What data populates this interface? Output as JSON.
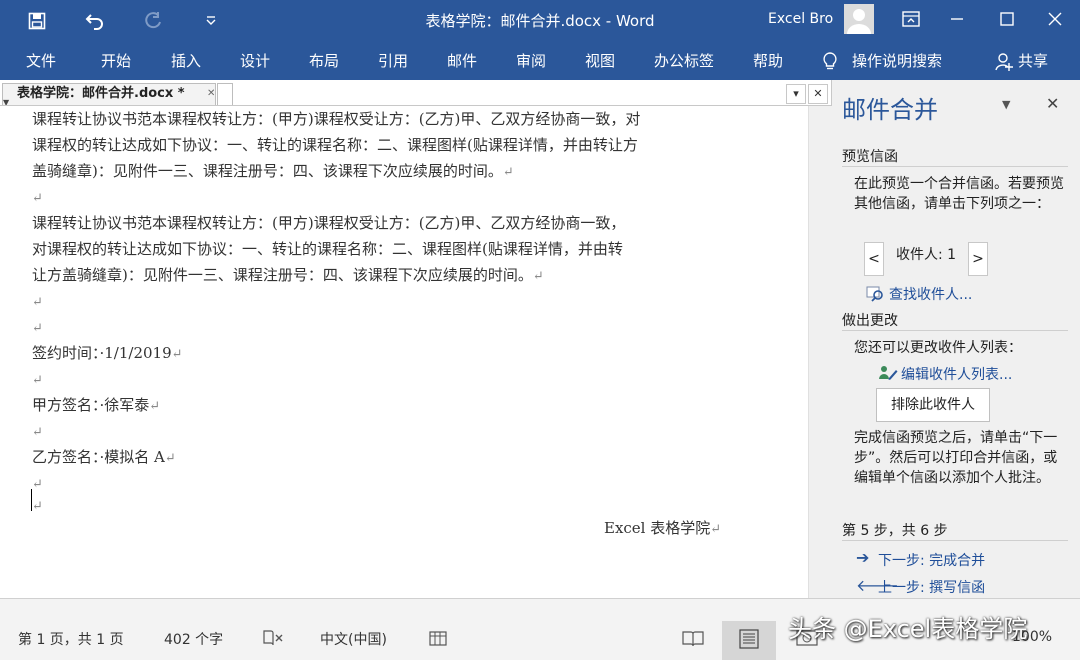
{
  "app": {
    "window_title": "表格学院：邮件合并.docx  -  Word",
    "user_name": "Excel Bro"
  },
  "ribbon": {
    "tabs": [
      "文件",
      "开始",
      "插入",
      "设计",
      "布局",
      "引用",
      "邮件",
      "审阅",
      "视图",
      "办公标签",
      "帮助"
    ],
    "tell_me": "操作说明搜索",
    "share": "共享"
  },
  "document": {
    "tab_name": "表格学院：邮件合并.docx *",
    "lines": [
      "课程转让协议书范本课程权转让方：(甲方)课程权受让方：(乙方)甲、乙双方经协商一致，对",
      "课程权的转让达成如下协议：一、转让的课程名称：二、课程图样(贴课程详情，并由转让方",
      "盖骑缝章)：见附件一三、课程注册号：四、该课程下次应续展的时间。",
      "",
      "课程转让协议书范本课程权转让方：(甲方)课程权受让方：(乙方)甲、乙双方经协商一致，",
      "对课程权的转让达成如下协议：一、转让的课程名称：二、课程图样(贴课程详情，并由转",
      "让方盖骑缝章)：见附件一三、课程注册号：四、该课程下次应续展的时间。",
      "",
      "",
      "签约时间：·1/1/2019",
      "",
      "甲方签名：·徐军泰",
      "",
      "乙方签名：·模拟名 A",
      "",
      ""
    ],
    "signature": "Excel 表格学院"
  },
  "pane": {
    "title": "邮件合并",
    "preview_title": "预览信函",
    "preview_text": "在此预览一个合并信函。若要预览其他信函，请单击下列项之一：",
    "recipient_label": "收件人: 1",
    "prev": "<",
    "next": ">",
    "find_recipient": "查找收件人...",
    "make_changes_title": "做出更改",
    "change_text": "您还可以更改收件人列表：",
    "edit_list": "编辑收件人列表...",
    "exclude_button": "排除此收件人",
    "finish_text": "完成信函预览之后，请单击“下一步”。然后可以打印合并信函，或编辑单个信函以添加个人批注。",
    "step_label": "第 5 步，共 6 步",
    "next_step": "下一步: 完成合并",
    "prev_step": "上一步: 撰写信函"
  },
  "status": {
    "page": "第 1 页，共 1 页",
    "words": "402 个字",
    "language": "中文(中国)",
    "zoom": "100%"
  },
  "watermark": "头条 @Excel表格学院",
  "colors": {
    "accent": "#2b579a",
    "link": "#1f4e99"
  }
}
